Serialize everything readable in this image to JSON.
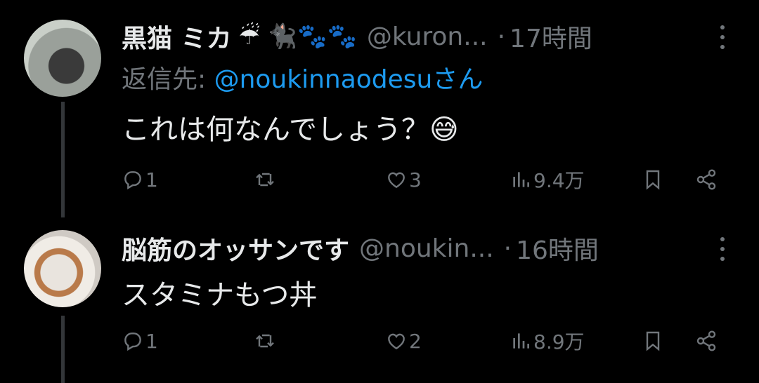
{
  "tweets": [
    {
      "name": "黒猫 ミカ",
      "name_emoji": "☔ 🐈‍⬛🐾🐾",
      "handle": "@kuron...",
      "separator": "·",
      "time": "17時間",
      "reply_prefix": "返信先: ",
      "reply_mention": "@noukinnaodesu",
      "reply_suffix": "さん",
      "text": "これは何なんでしょう？😅",
      "replies": "1",
      "retweets": "",
      "likes": "3",
      "views": "9.4万"
    },
    {
      "name": "脳筋のオッサンです",
      "handle": "@noukin...",
      "separator": "·",
      "time": "16時間",
      "text": "スタミナもつ丼",
      "replies": "1",
      "retweets": "",
      "likes": "2",
      "views": "8.9万"
    }
  ],
  "colors": {
    "background": "#000000",
    "text": "#e7e9ea",
    "secondary": "#71767b",
    "link": "#1d9bf0"
  },
  "icons": [
    "reply-icon",
    "retweet-icon",
    "like-icon",
    "views-icon",
    "bookmark-icon",
    "share-icon",
    "more-icon"
  ]
}
